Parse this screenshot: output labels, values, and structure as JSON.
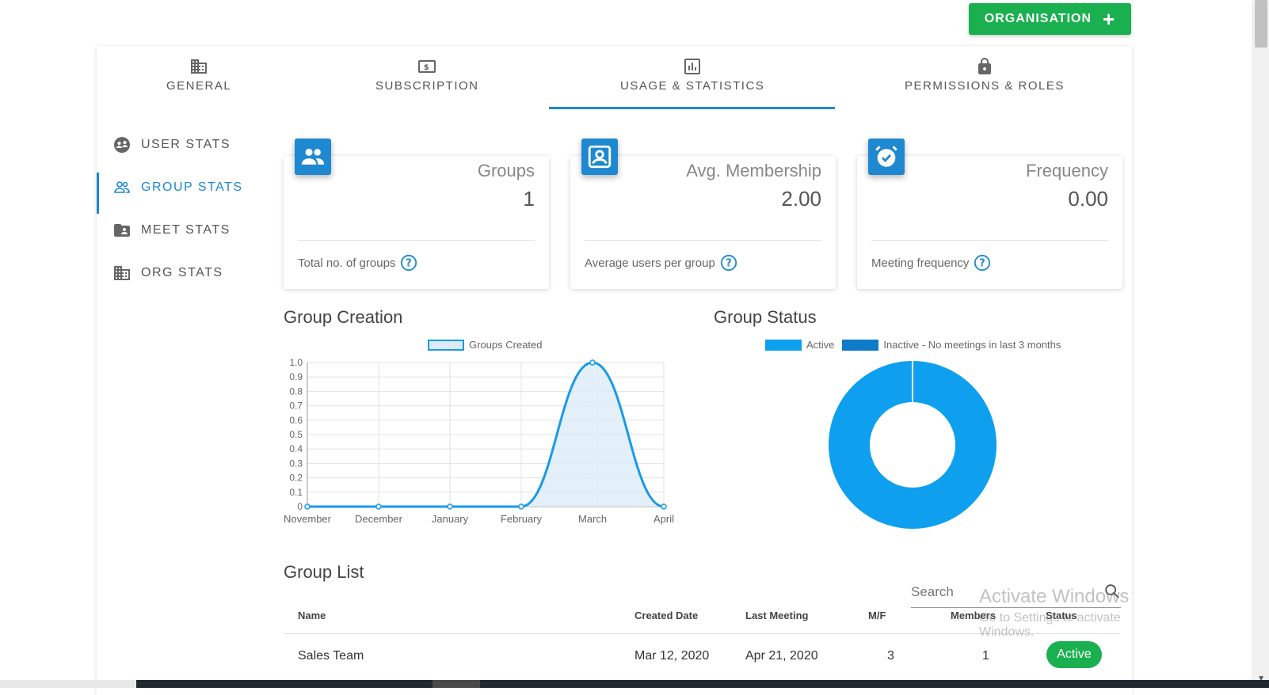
{
  "header": {
    "org_button_label": "ORGANISATION"
  },
  "tabs": [
    {
      "label": "GENERAL",
      "icon": "building-icon"
    },
    {
      "label": "SUBSCRIPTION",
      "icon": "dollar-icon"
    },
    {
      "label": "USAGE & STATISTICS",
      "icon": "bar-chart-icon",
      "active": true
    },
    {
      "label": "PERMISSIONS & ROLES",
      "icon": "lock-icon"
    }
  ],
  "sidebar": {
    "items": [
      {
        "label": "USER STATS",
        "icon": "user-stats-icon"
      },
      {
        "label": "GROUP STATS",
        "icon": "group-icon",
        "active": true
      },
      {
        "label": "MEET STATS",
        "icon": "folder-user-icon"
      },
      {
        "label": "ORG STATS",
        "icon": "building-icon"
      }
    ]
  },
  "cards": [
    {
      "title": "Groups",
      "value": "1",
      "footer": "Total no. of groups",
      "icon": "group-icon"
    },
    {
      "title": "Avg. Membership",
      "value": "2.00",
      "footer": "Average users per group",
      "icon": "user-badge-icon"
    },
    {
      "title": "Frequency",
      "value": "0.00",
      "footer": "Meeting frequency",
      "icon": "alarm-check-icon"
    }
  ],
  "group_creation": {
    "title": "Group Creation",
    "legend": "Groups Created"
  },
  "group_status": {
    "title": "Group Status",
    "legend_active": "Active",
    "legend_inactive": "Inactive - No meetings in last 3 months"
  },
  "chart_data": [
    {
      "type": "area",
      "title": "Group Creation",
      "categories": [
        "November",
        "December",
        "January",
        "February",
        "March",
        "April"
      ],
      "series": [
        {
          "name": "Groups Created",
          "values": [
            0,
            0,
            0,
            0,
            1,
            0
          ]
        }
      ],
      "ylim": [
        0,
        1.0
      ],
      "yticks": [
        "0",
        "0.1",
        "0.2",
        "0.3",
        "0.4",
        "0.5",
        "0.6",
        "0.7",
        "0.8",
        "0.9",
        "1.0"
      ],
      "grid": true,
      "legend": "top",
      "colors": {
        "line": "#1a9ae8",
        "fill": "#dcebf7"
      }
    },
    {
      "type": "pie",
      "title": "Group Status",
      "labels": [
        "Active",
        "Inactive - No meetings in last 3 months"
      ],
      "values": [
        1,
        0
      ],
      "colors": [
        "#0ea0ee",
        "#0d7bc8"
      ],
      "legend": "top"
    }
  ],
  "group_list": {
    "title": "Group List",
    "search_placeholder": "Search",
    "columns": [
      "Name",
      "Created Date",
      "Last Meeting",
      "M/F",
      "Members",
      "Status"
    ],
    "rows": [
      {
        "name": "Sales Team",
        "created": "Mar 12, 2020",
        "last_meeting": "Apr 21, 2020",
        "mf": "3",
        "members": "1",
        "status": "Active"
      }
    ]
  },
  "watermark": {
    "line1": "Activate Windows",
    "line2": "Go to Settings to activate Windows."
  },
  "colors": {
    "accent": "#1e88d0",
    "success": "#1ab04f"
  }
}
